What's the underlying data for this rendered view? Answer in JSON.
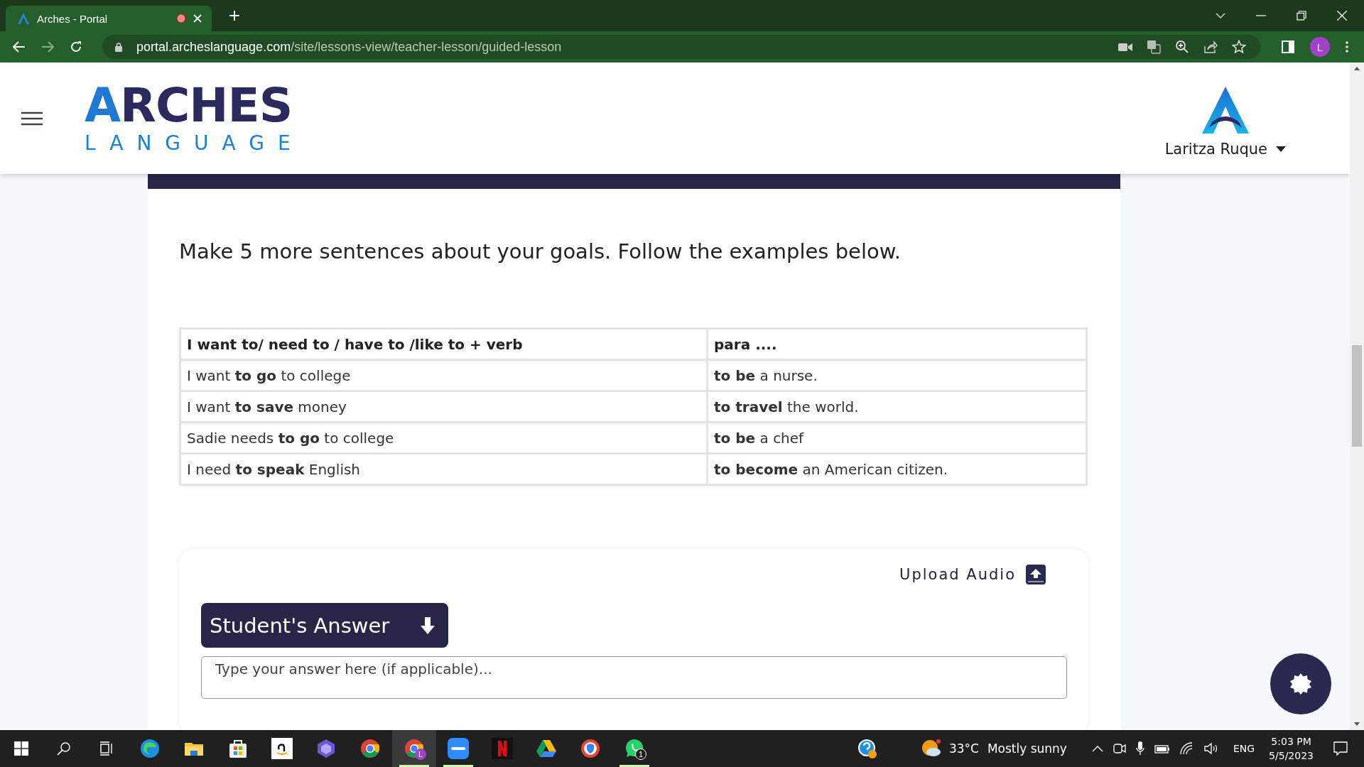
{
  "browser": {
    "tab": {
      "title": "Arches - Portal",
      "selected": true
    },
    "url": {
      "domain": "portal.archeslanguage.com",
      "path": "/site/lessons-view/teacher-lesson/guided-lesson"
    },
    "profile_initial": "L"
  },
  "header": {
    "logo_top": "ARCHES",
    "logo_bottom": "LANGUAGE",
    "user_name": "Laritza Ruque"
  },
  "instruction": "Make 5 more sentences about your goals. Follow the examples below.",
  "table": {
    "columns": [
      "I want to/ need to / have to /like to + verb",
      "para ...."
    ],
    "rows": [
      [
        "I want **to go** to college",
        "**to be** a nurse."
      ],
      [
        "I want **to save** money",
        "**to travel** the world."
      ],
      [
        "Sadie needs **to go** to college",
        "**to be** a chef"
      ],
      [
        "I need **to speak** English",
        "**to become** an American citizen."
      ]
    ]
  },
  "answer": {
    "upload_label": "Upload Audio",
    "student_answer_button": "Student's Answer",
    "placeholder": "Type your answer here (if applicable)..."
  },
  "taskbar": {
    "apps": [
      {
        "selected": false,
        "open": false
      },
      {
        "selected": false,
        "open": false
      },
      {
        "selected": false,
        "open": false
      },
      {
        "selected": false,
        "open": false
      },
      {
        "selected": false,
        "open": false
      },
      {
        "selected": false,
        "open": false
      },
      {
        "selected": true,
        "open": true,
        "badge": "L"
      },
      {
        "selected": false,
        "open": true
      },
      {
        "selected": false,
        "open": false
      },
      {
        "selected": false,
        "open": false
      },
      {
        "selected": false,
        "open": false
      },
      {
        "selected": false,
        "open": true,
        "badge": "1"
      }
    ],
    "temperature": "33°C",
    "weather": "Mostly sunny",
    "language": "ENG",
    "time": "5:03 PM",
    "date": "5/5/2023"
  }
}
